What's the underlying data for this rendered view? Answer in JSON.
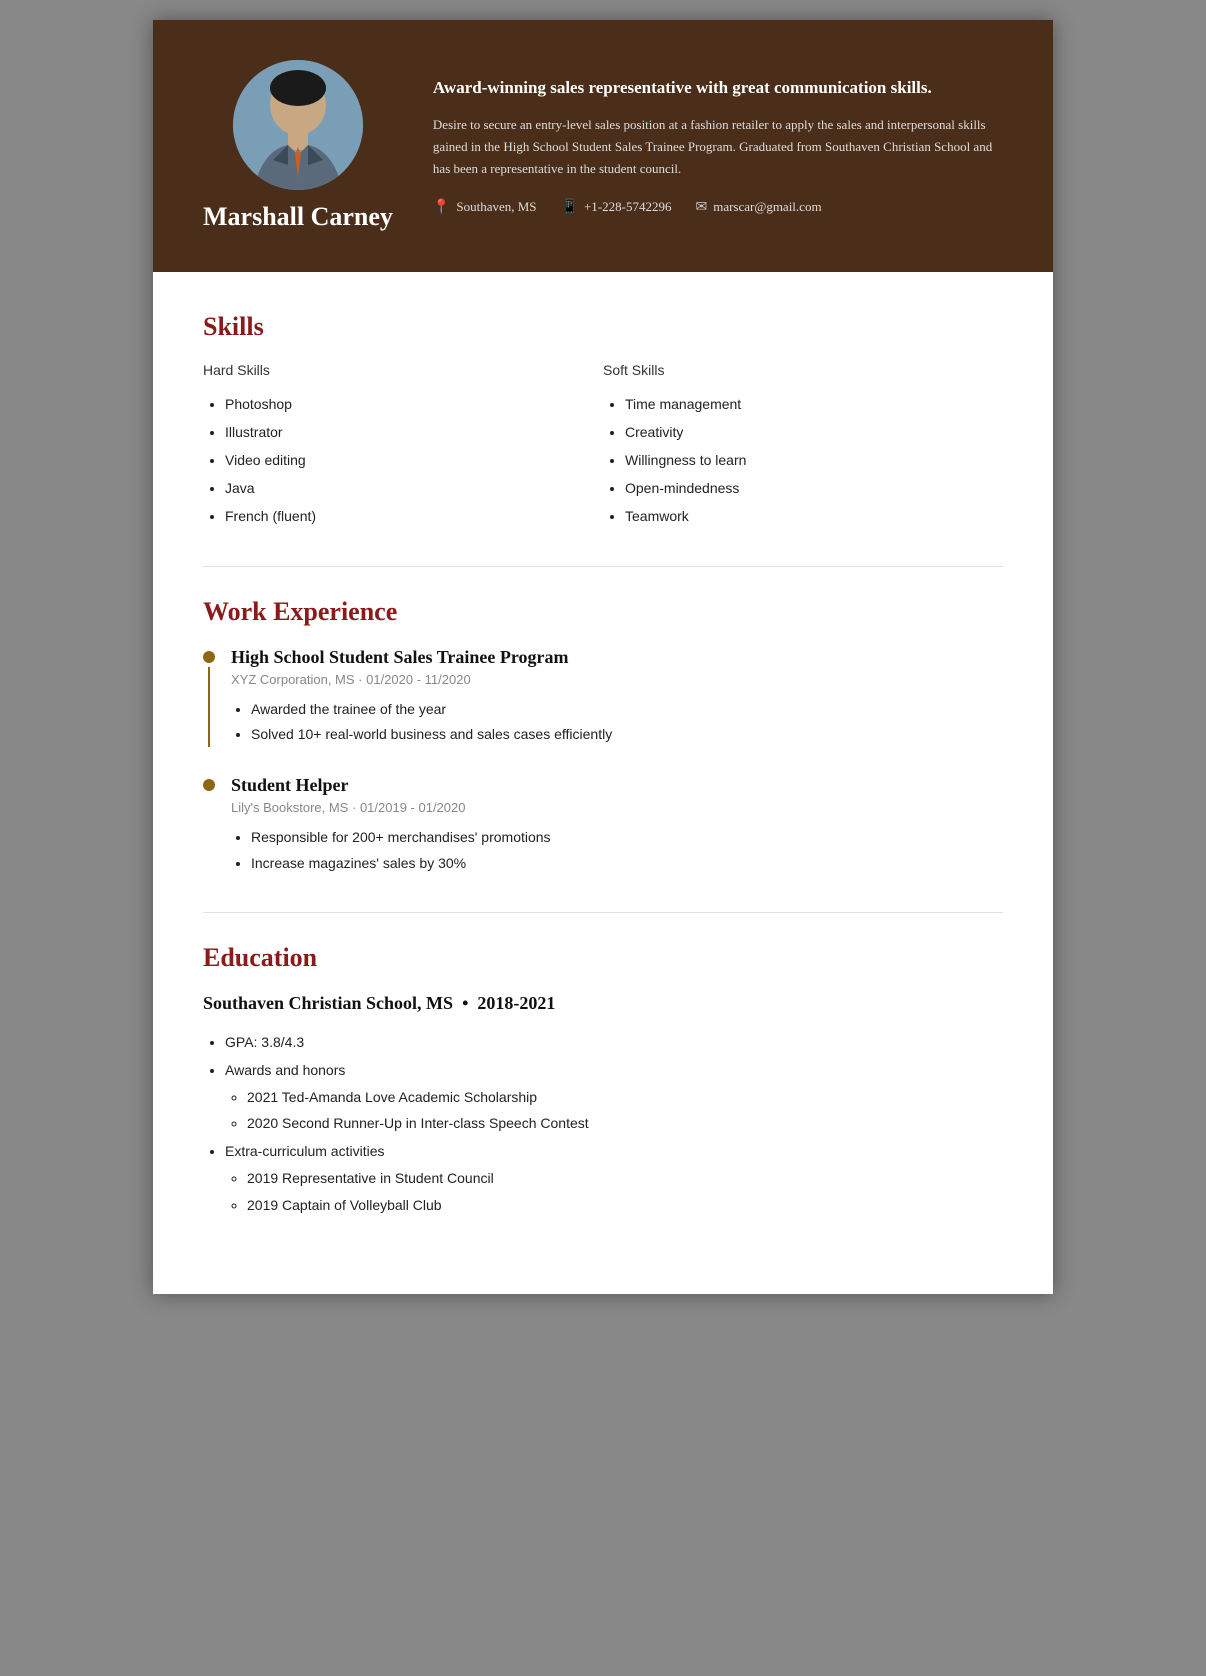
{
  "header": {
    "name": "Marshall Carney",
    "tagline": "Award-winning sales representative with great communication skills.",
    "summary": "Desire to secure an entry-level sales position at a fashion retailer to apply the sales and interpersonal skills gained in the High School Student Sales Trainee Program. Graduated from Southaven Christian School and has been a representative in the student council.",
    "contact": {
      "location": "Southaven, MS",
      "phone": "+1-228-5742296",
      "email": "marscar@gmail.com"
    }
  },
  "skills": {
    "section_title": "Skills",
    "hard_skills_label": "Hard Skills",
    "hard_skills": [
      "Photoshop",
      "Illustrator",
      "Video editing",
      "Java",
      "French (fluent)"
    ],
    "soft_skills_label": "Soft Skills",
    "soft_skills": [
      "Time management",
      "Creativity",
      "Willingness to learn",
      "Open-mindedness",
      "Teamwork"
    ]
  },
  "work_experience": {
    "section_title": "Work Experience",
    "jobs": [
      {
        "title": "High School Student Sales Trainee Program",
        "company": "XYZ Corporation, MS",
        "dates": "01/2020 - 11/2020",
        "bullets": [
          "Awarded the trainee of the year",
          "Solved 10+ real-world business and sales cases efficiently"
        ]
      },
      {
        "title": "Student Helper",
        "company": "Lily's Bookstore, MS",
        "dates": "01/2019 - 01/2020",
        "bullets": [
          "Responsible for 200+ merchandises' promotions",
          "Increase magazines' sales by 30%"
        ]
      }
    ]
  },
  "education": {
    "section_title": "Education",
    "school": "Southaven Christian School, MS",
    "years": "2018-2021",
    "gpa": "GPA: 3.8/4.3",
    "awards_label": "Awards and honors",
    "awards": [
      "2021 Ted-Amanda Love Academic Scholarship",
      "2020 Second Runner-Up in Inter-class Speech Contest"
    ],
    "activities_label": "Extra-curriculum activities",
    "activities": [
      "2019 Representative in Student Council",
      "2019 Captain of Volleyball Club"
    ]
  }
}
